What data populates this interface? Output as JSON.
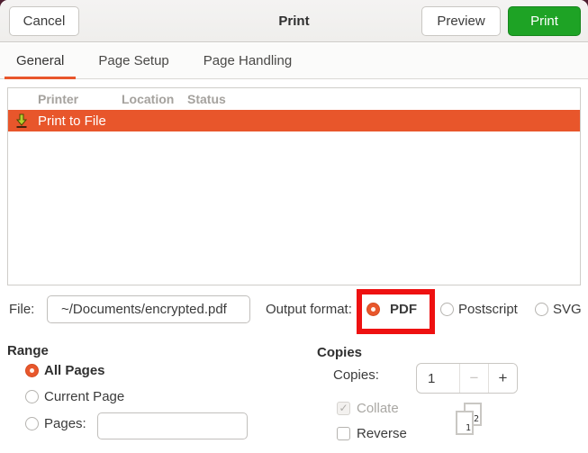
{
  "header": {
    "title": "Print",
    "cancel_label": "Cancel",
    "preview_label": "Preview",
    "print_label": "Print"
  },
  "tabs": [
    {
      "label": "General",
      "active": true
    },
    {
      "label": "Page Setup",
      "active": false
    },
    {
      "label": "Page Handling",
      "active": false
    }
  ],
  "printer_list": {
    "columns": [
      "Printer",
      "Location",
      "Status"
    ],
    "rows": [
      {
        "printer": "Print to File",
        "location": "",
        "status": "",
        "selected": true,
        "icon": "save-to-file-icon"
      }
    ]
  },
  "file_row": {
    "label": "File:",
    "value": "~/Documents/encrypted.pdf",
    "output_format_label": "Output format:",
    "options": [
      {
        "label": "PDF",
        "selected": true,
        "annotated": true
      },
      {
        "label": "Postscript",
        "selected": false
      },
      {
        "label": "SVG",
        "selected": false
      }
    ]
  },
  "range": {
    "heading": "Range",
    "options": [
      {
        "label": "All Pages",
        "selected": true
      },
      {
        "label": "Current Page",
        "selected": false
      },
      {
        "label": "Pages:",
        "selected": false,
        "input_value": ""
      }
    ]
  },
  "copies": {
    "heading": "Copies",
    "label": "Copies:",
    "value": "1",
    "minus_label": "−",
    "plus_label": "+",
    "collate": {
      "label": "Collate",
      "checked": true,
      "disabled": true,
      "checkmark": "✓"
    },
    "reverse": {
      "label": "Reverse",
      "checked": false
    },
    "collate_preview": {
      "front_page_number": "1",
      "back_page_number": "2"
    }
  },
  "colors": {
    "accent_orange": "#e8562b",
    "annotation_red": "#ee1111",
    "print_green": "#1ea325"
  }
}
